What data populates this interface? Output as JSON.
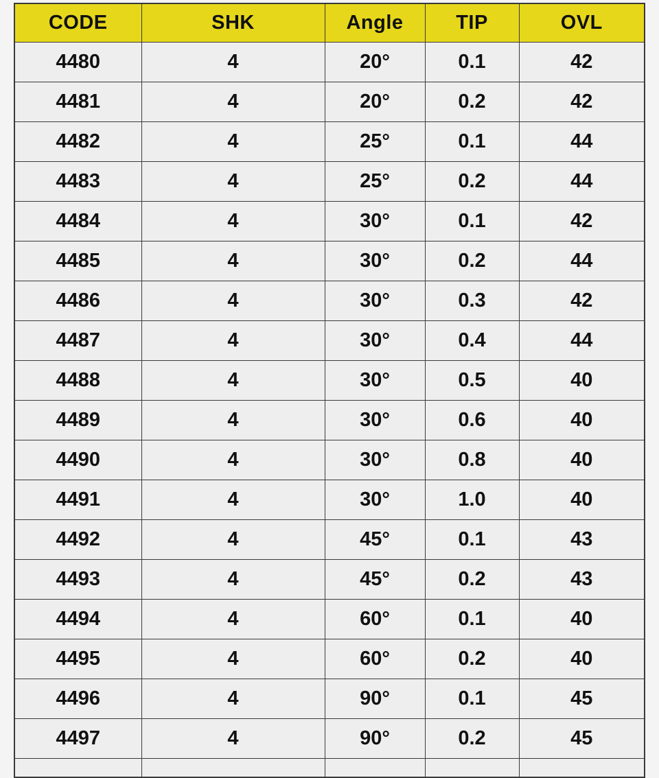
{
  "table": {
    "name": "tooling-specification-table",
    "accent_header_color": "#e6d71b",
    "cell_background_color": "#eeeeee",
    "border_color": "#3a3a3a",
    "columns": [
      {
        "key": "code",
        "label": "CODE"
      },
      {
        "key": "shk",
        "label": "SHK"
      },
      {
        "key": "angle",
        "label": "Angle"
      },
      {
        "key": "tip",
        "label": "TIP"
      },
      {
        "key": "ovl",
        "label": "OVL"
      }
    ],
    "rows": [
      {
        "code": "4480",
        "shk": "4",
        "angle": "20°",
        "tip": "0.1",
        "ovl": "42"
      },
      {
        "code": "4481",
        "shk": "4",
        "angle": "20°",
        "tip": "0.2",
        "ovl": "42"
      },
      {
        "code": "4482",
        "shk": "4",
        "angle": "25°",
        "tip": "0.1",
        "ovl": "44"
      },
      {
        "code": "4483",
        "shk": "4",
        "angle": "25°",
        "tip": "0.2",
        "ovl": "44"
      },
      {
        "code": "4484",
        "shk": "4",
        "angle": "30°",
        "tip": "0.1",
        "ovl": "42"
      },
      {
        "code": "4485",
        "shk": "4",
        "angle": "30°",
        "tip": "0.2",
        "ovl": "44"
      },
      {
        "code": "4486",
        "shk": "4",
        "angle": "30°",
        "tip": "0.3",
        "ovl": "42"
      },
      {
        "code": "4487",
        "shk": "4",
        "angle": "30°",
        "tip": "0.4",
        "ovl": "44"
      },
      {
        "code": "4488",
        "shk": "4",
        "angle": "30°",
        "tip": "0.5",
        "ovl": "40"
      },
      {
        "code": "4489",
        "shk": "4",
        "angle": "30°",
        "tip": "0.6",
        "ovl": "40"
      },
      {
        "code": "4490",
        "shk": "4",
        "angle": "30°",
        "tip": "0.8",
        "ovl": "40"
      },
      {
        "code": "4491",
        "shk": "4",
        "angle": "30°",
        "tip": "1.0",
        "ovl": "40"
      },
      {
        "code": "4492",
        "shk": "4",
        "angle": "45°",
        "tip": "0.1",
        "ovl": "43"
      },
      {
        "code": "4493",
        "shk": "4",
        "angle": "45°",
        "tip": "0.2",
        "ovl": "43"
      },
      {
        "code": "4494",
        "shk": "4",
        "angle": "60°",
        "tip": "0.1",
        "ovl": "40"
      },
      {
        "code": "4495",
        "shk": "4",
        "angle": "60°",
        "tip": "0.2",
        "ovl": "40"
      },
      {
        "code": "4496",
        "shk": "4",
        "angle": "90°",
        "tip": "0.1",
        "ovl": "45"
      },
      {
        "code": "4497",
        "shk": "4",
        "angle": "90°",
        "tip": "0.2",
        "ovl": "45"
      }
    ],
    "truncated_row_visible": true
  }
}
